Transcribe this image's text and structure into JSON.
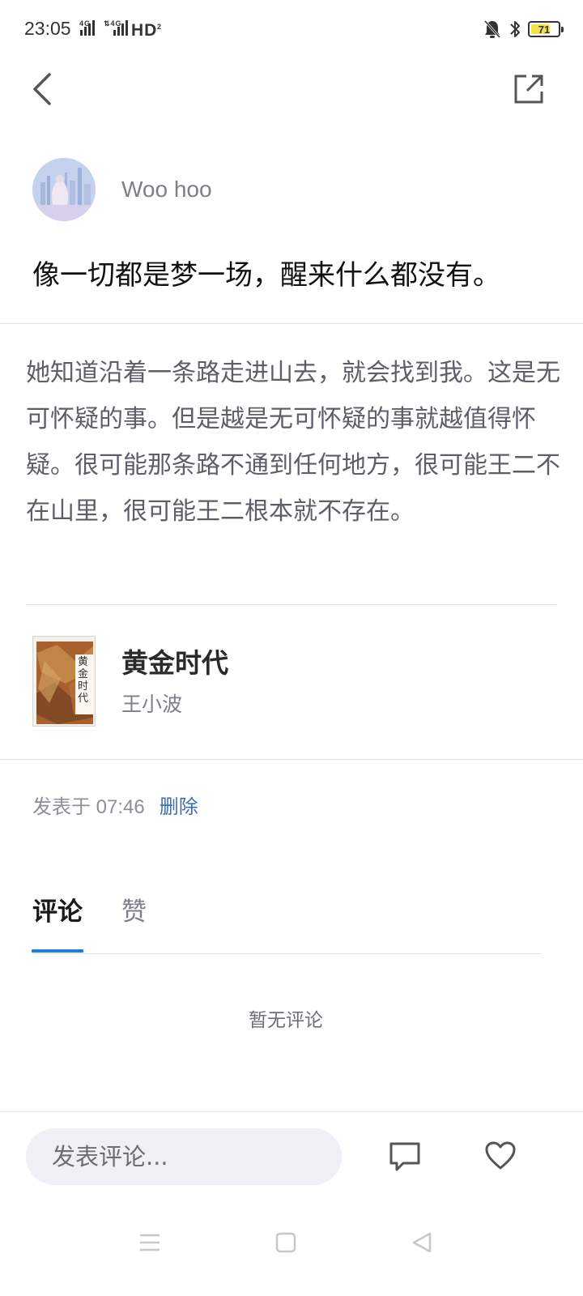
{
  "status_bar": {
    "time": "23:05",
    "network": "⁴ᴳ ull ⁴ᴳ ull HD",
    "battery_level": "71",
    "battery_fraction": 0.71
  },
  "nav": {
    "back_icon": "chevron-left",
    "share_icon": "share-external"
  },
  "post": {
    "author_name": "Woo hoo",
    "headline": "像一切都是梦一场，醒来什么都没有。",
    "excerpt": "她知道沿着一条路走进山去，就会找到我。这是无可怀疑的事。但是越是无可怀疑的事就越值得怀疑。很可能那条路不通到任何地方，很可能王二不在山里，很可能王二根本就不存在。",
    "book": {
      "title": "黄金时代",
      "author": "王小波",
      "cover_title": "黄金时代"
    },
    "posted_at": "发表于 07:46",
    "delete_label": "删除"
  },
  "tabs": [
    {
      "label": "评论",
      "active": true
    },
    {
      "label": "赞",
      "active": false
    }
  ],
  "comments": {
    "empty_text": "暂无评论"
  },
  "bottom_bar": {
    "input_placeholder": "发表评论..."
  },
  "colors": {
    "accent": "#1e7fd6",
    "link": "#3c6eb0",
    "input_bg": "#eef0f5"
  }
}
